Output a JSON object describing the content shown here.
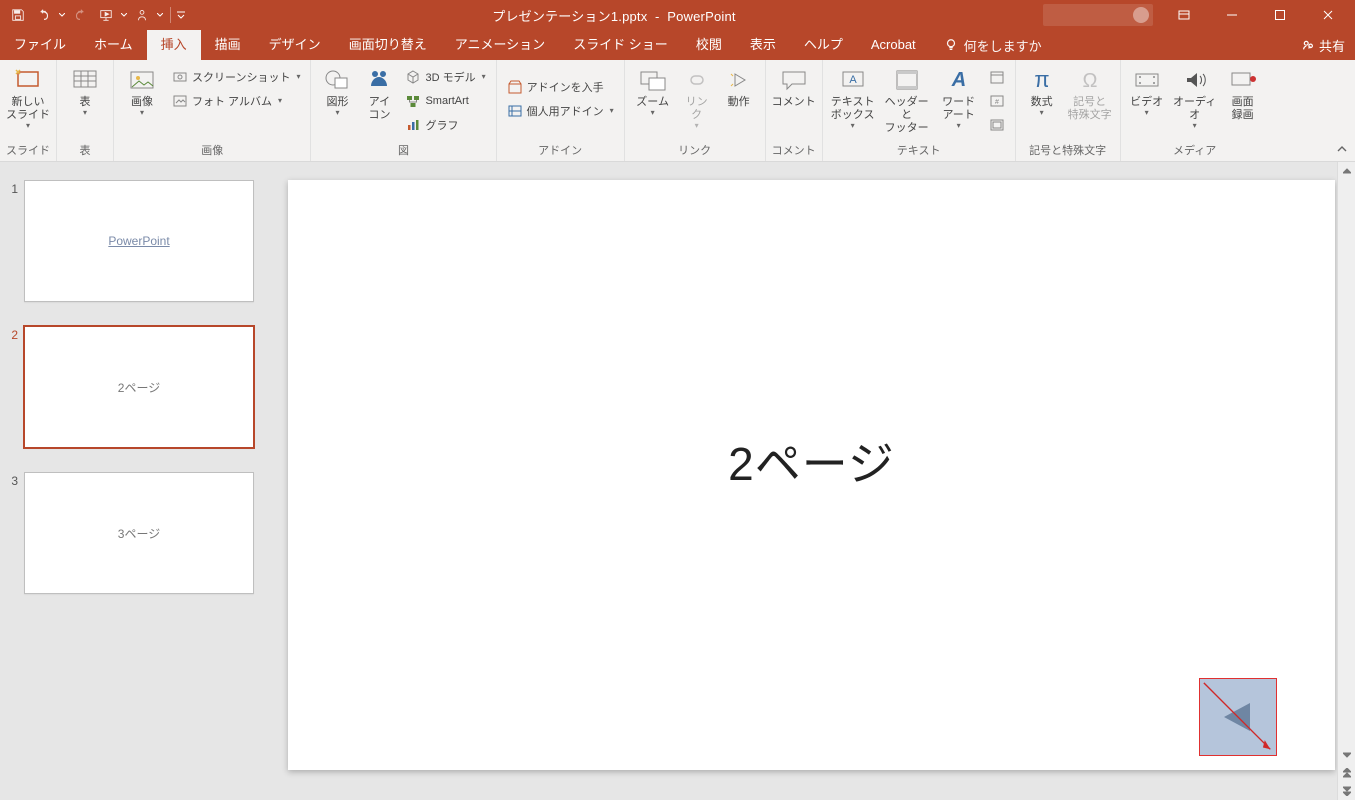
{
  "app": {
    "filename": "プレゼンテーション1.pptx",
    "appname": "PowerPoint"
  },
  "tabs": {
    "file": "ファイル",
    "home": "ホーム",
    "insert": "挿入",
    "draw": "描画",
    "design": "デザイン",
    "transitions": "画面切り替え",
    "animations": "アニメーション",
    "slideshow": "スライド ショー",
    "review": "校閲",
    "view": "表示",
    "help": "ヘルプ",
    "acrobat": "Acrobat",
    "tellme": "何をしますか",
    "share": "共有"
  },
  "ribbon": {
    "slides": {
      "label": "スライド",
      "new_slide": "新しい\nスライド"
    },
    "tables": {
      "label": "表",
      "table": "表"
    },
    "images": {
      "label": "画像",
      "pictures": "画像",
      "screenshot": "スクリーンショット",
      "photo_album": "フォト アルバム"
    },
    "illustrations": {
      "label": "図",
      "shapes": "図形",
      "icons": "アイ\nコン",
      "models3d": "3D モデル",
      "smartart": "SmartArt",
      "chart": "グラフ"
    },
    "addins": {
      "label": "アドイン",
      "get": "アドインを入手",
      "my": "個人用アドイン"
    },
    "links": {
      "label": "リンク",
      "zoom": "ズーム",
      "link": "リン\nク",
      "action": "動作"
    },
    "comments": {
      "label": "コメント",
      "comment": "コメント"
    },
    "text": {
      "label": "テキスト",
      "textbox": "テキスト\nボックス",
      "headerfooter": "ヘッダーと\nフッター",
      "wordart": "ワード\nアート"
    },
    "symbols": {
      "label": "記号と特殊文字",
      "equation": "数式",
      "symbol": "記号と\n特殊文字"
    },
    "media": {
      "label": "メディア",
      "video": "ビデオ",
      "audio": "オーディオ",
      "screenrec": "画面\n録画"
    }
  },
  "thumbnails": [
    {
      "num": "1",
      "content": "PowerPoint",
      "kind": "link",
      "selected": false
    },
    {
      "num": "2",
      "content": "2ページ",
      "kind": "text",
      "selected": true
    },
    {
      "num": "3",
      "content": "3ページ",
      "kind": "text",
      "selected": false
    }
  ],
  "slide": {
    "title": "2ページ"
  }
}
